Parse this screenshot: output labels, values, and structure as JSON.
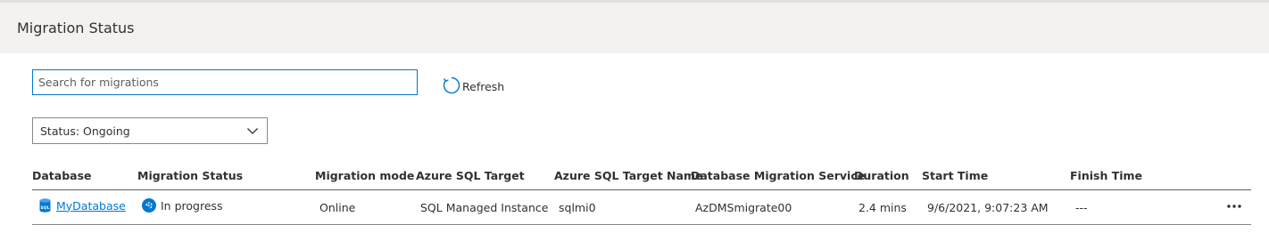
{
  "header": {
    "title": "Migration Status"
  },
  "search": {
    "placeholder": "Search for migrations",
    "value": ""
  },
  "refresh": {
    "label": "Refresh"
  },
  "status_filter": {
    "selected": "Status: Ongoing"
  },
  "table": {
    "columns": [
      "Database",
      "Migration Status",
      "Migration mode",
      "Azure SQL Target",
      "Azure SQL Target Name",
      "Database Migration Service",
      "Duration",
      "Start Time",
      "Finish Time"
    ],
    "rows": [
      {
        "database": "MyDatabase",
        "migration_status": "In progress",
        "migration_mode": "Online",
        "azure_sql_target": "SQL Managed Instance",
        "azure_sql_target_name": "sqlmi0",
        "database_migration_service": "AzDMSmigrate00",
        "duration": "2.4 mins",
        "start_time": "9/6/2021, 9:07:23 AM",
        "finish_time": "---"
      }
    ]
  },
  "colors": {
    "accent": "#0078d4",
    "header_bg": "#f3f2f1",
    "text": "#323130"
  }
}
